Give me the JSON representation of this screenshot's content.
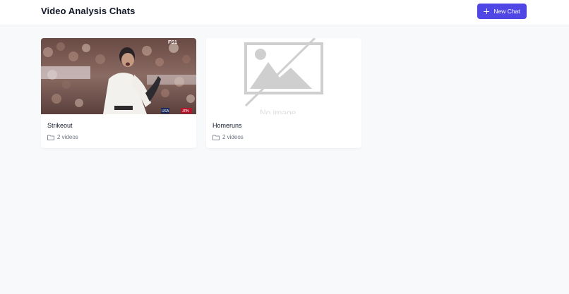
{
  "header": {
    "title": "Video Analysis Chats",
    "new_chat_label": "New Chat"
  },
  "chats": [
    {
      "name": "Strikeout",
      "meta": "2 videos",
      "thumbnail": "baseball-celebration-photo",
      "overlay": {
        "network": "FS1",
        "team_left": "USA",
        "team_right": "JPN"
      }
    },
    {
      "name": "Homeruns",
      "meta": "2 videos",
      "thumbnail": "no-image-placeholder",
      "placeholder_text": "No image"
    }
  ],
  "colors": {
    "accent": "#5046e5",
    "background": "#f8f9fb"
  },
  "icons": [
    "plus-icon",
    "folder-icon",
    "no-image-icon"
  ]
}
